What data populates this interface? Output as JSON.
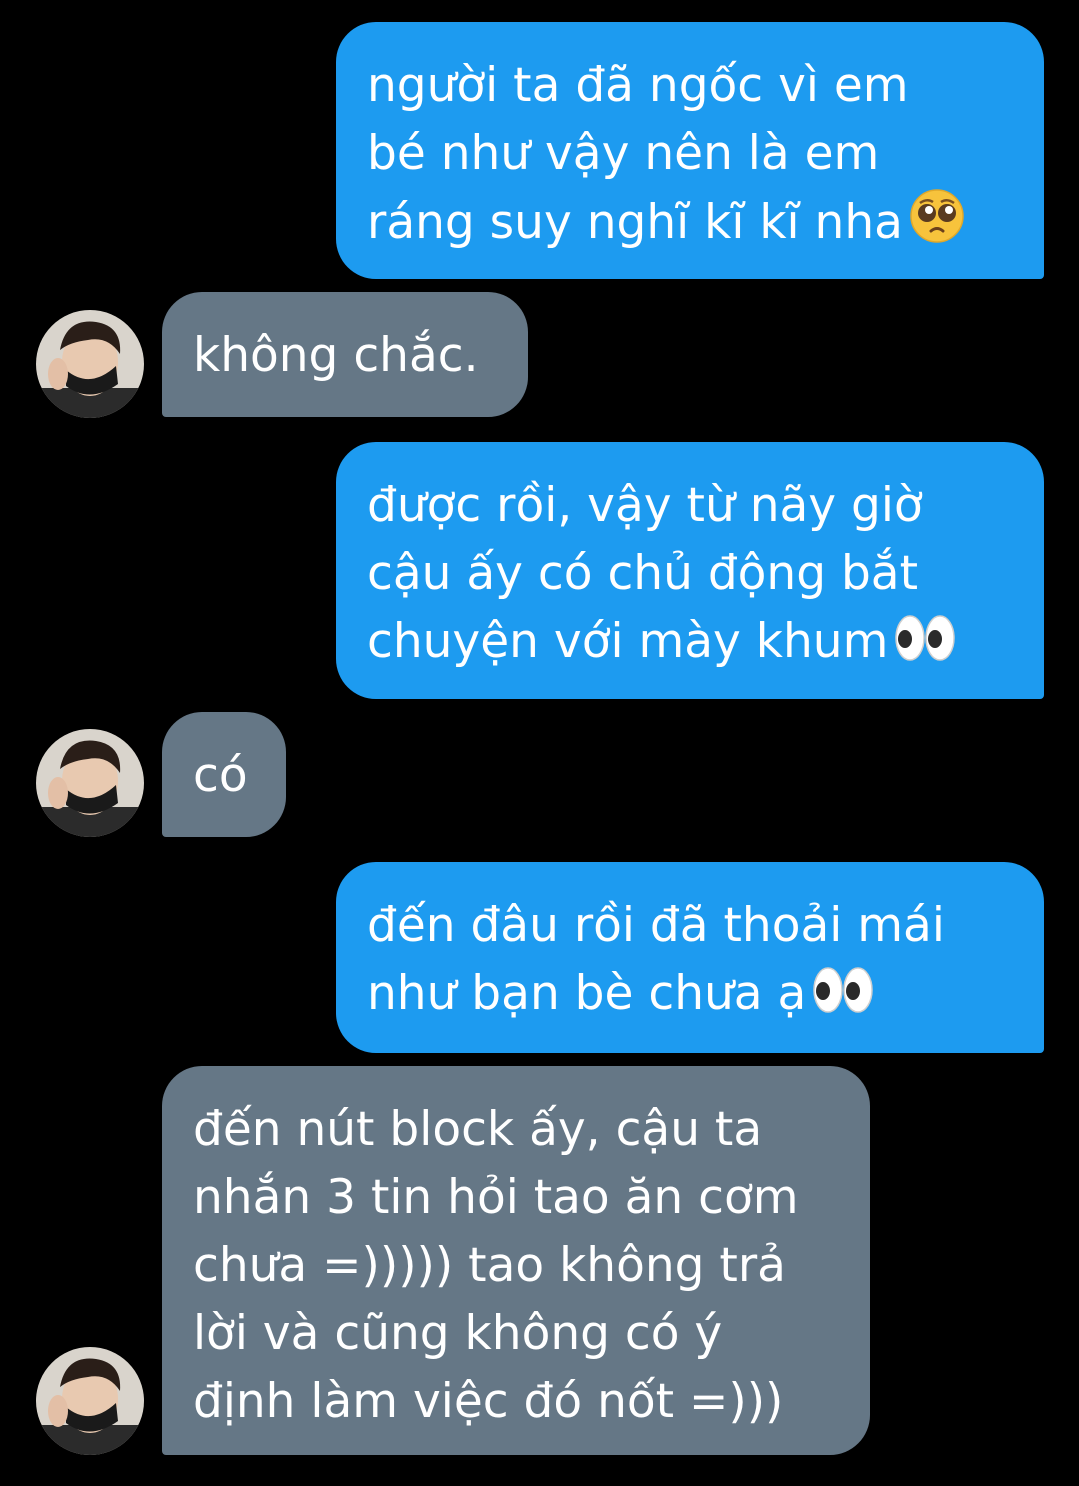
{
  "conversation": {
    "messages": [
      {
        "direction": "outgoing",
        "lines": [
          "người ta đã ngốc vì em",
          "bé như vậy nên là em",
          "ráng suy nghĩ kĩ kĩ nha"
        ],
        "emoji": "pleading-face"
      },
      {
        "direction": "incoming",
        "lines": [
          "không chắc."
        ]
      },
      {
        "direction": "outgoing",
        "lines": [
          "được rồi, vậy từ nãy giờ",
          "cậu ấy có chủ động bắt",
          "chuyện với mày khum"
        ],
        "emoji": "eyes"
      },
      {
        "direction": "incoming",
        "lines": [
          "có"
        ]
      },
      {
        "direction": "outgoing",
        "lines": [
          "đến đâu rồi đã thoải mái",
          "như bạn bè chưa ạ"
        ],
        "emoji": "eyes"
      },
      {
        "direction": "incoming",
        "lines": [
          "đến nút block ấy, cậu ta",
          "nhắn 3 tin hỏi tao ăn cơm",
          "chưa =))))) tao không trả",
          "lời và cũng không có ý",
          "định làm việc đó nốt =)))"
        ]
      }
    ]
  },
  "colors": {
    "background": "#000000",
    "outgoing_bubble": "#1d9bf0",
    "incoming_bubble": "#657786",
    "text": "#ffffff"
  }
}
